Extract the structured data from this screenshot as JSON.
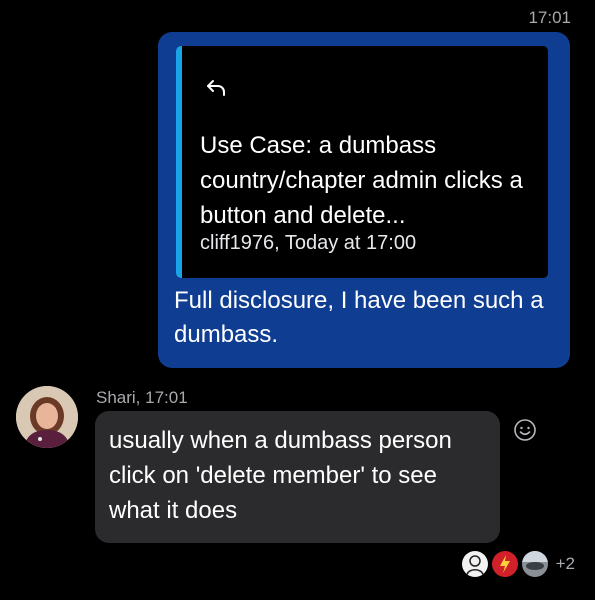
{
  "header": {
    "time": "17:01"
  },
  "outgoing": {
    "quote": {
      "text": "Use Case: a dumbass country/chapter admin clicks a button and delete...",
      "meta": "cliff1976, Today at 17:00",
      "reply_icon": "reply-arrow-icon"
    },
    "text": "Full disclosure, I have been such a dumbass.",
    "bubble_color": "#0f3d91",
    "quote_accent_color": "#1aa3e8"
  },
  "incoming": {
    "sender_line": "Shari, 17:01",
    "avatar_icon": "avatar",
    "text": "usually when a dumbass person click on 'delete member' to see what it does",
    "bubble_color": "#2b2b2d",
    "react_icon": "smiley-icon"
  },
  "seen_by": {
    "avatars": [
      "seen-avatar-1",
      "seen-avatar-2",
      "seen-avatar-3"
    ],
    "extra": "+2"
  }
}
